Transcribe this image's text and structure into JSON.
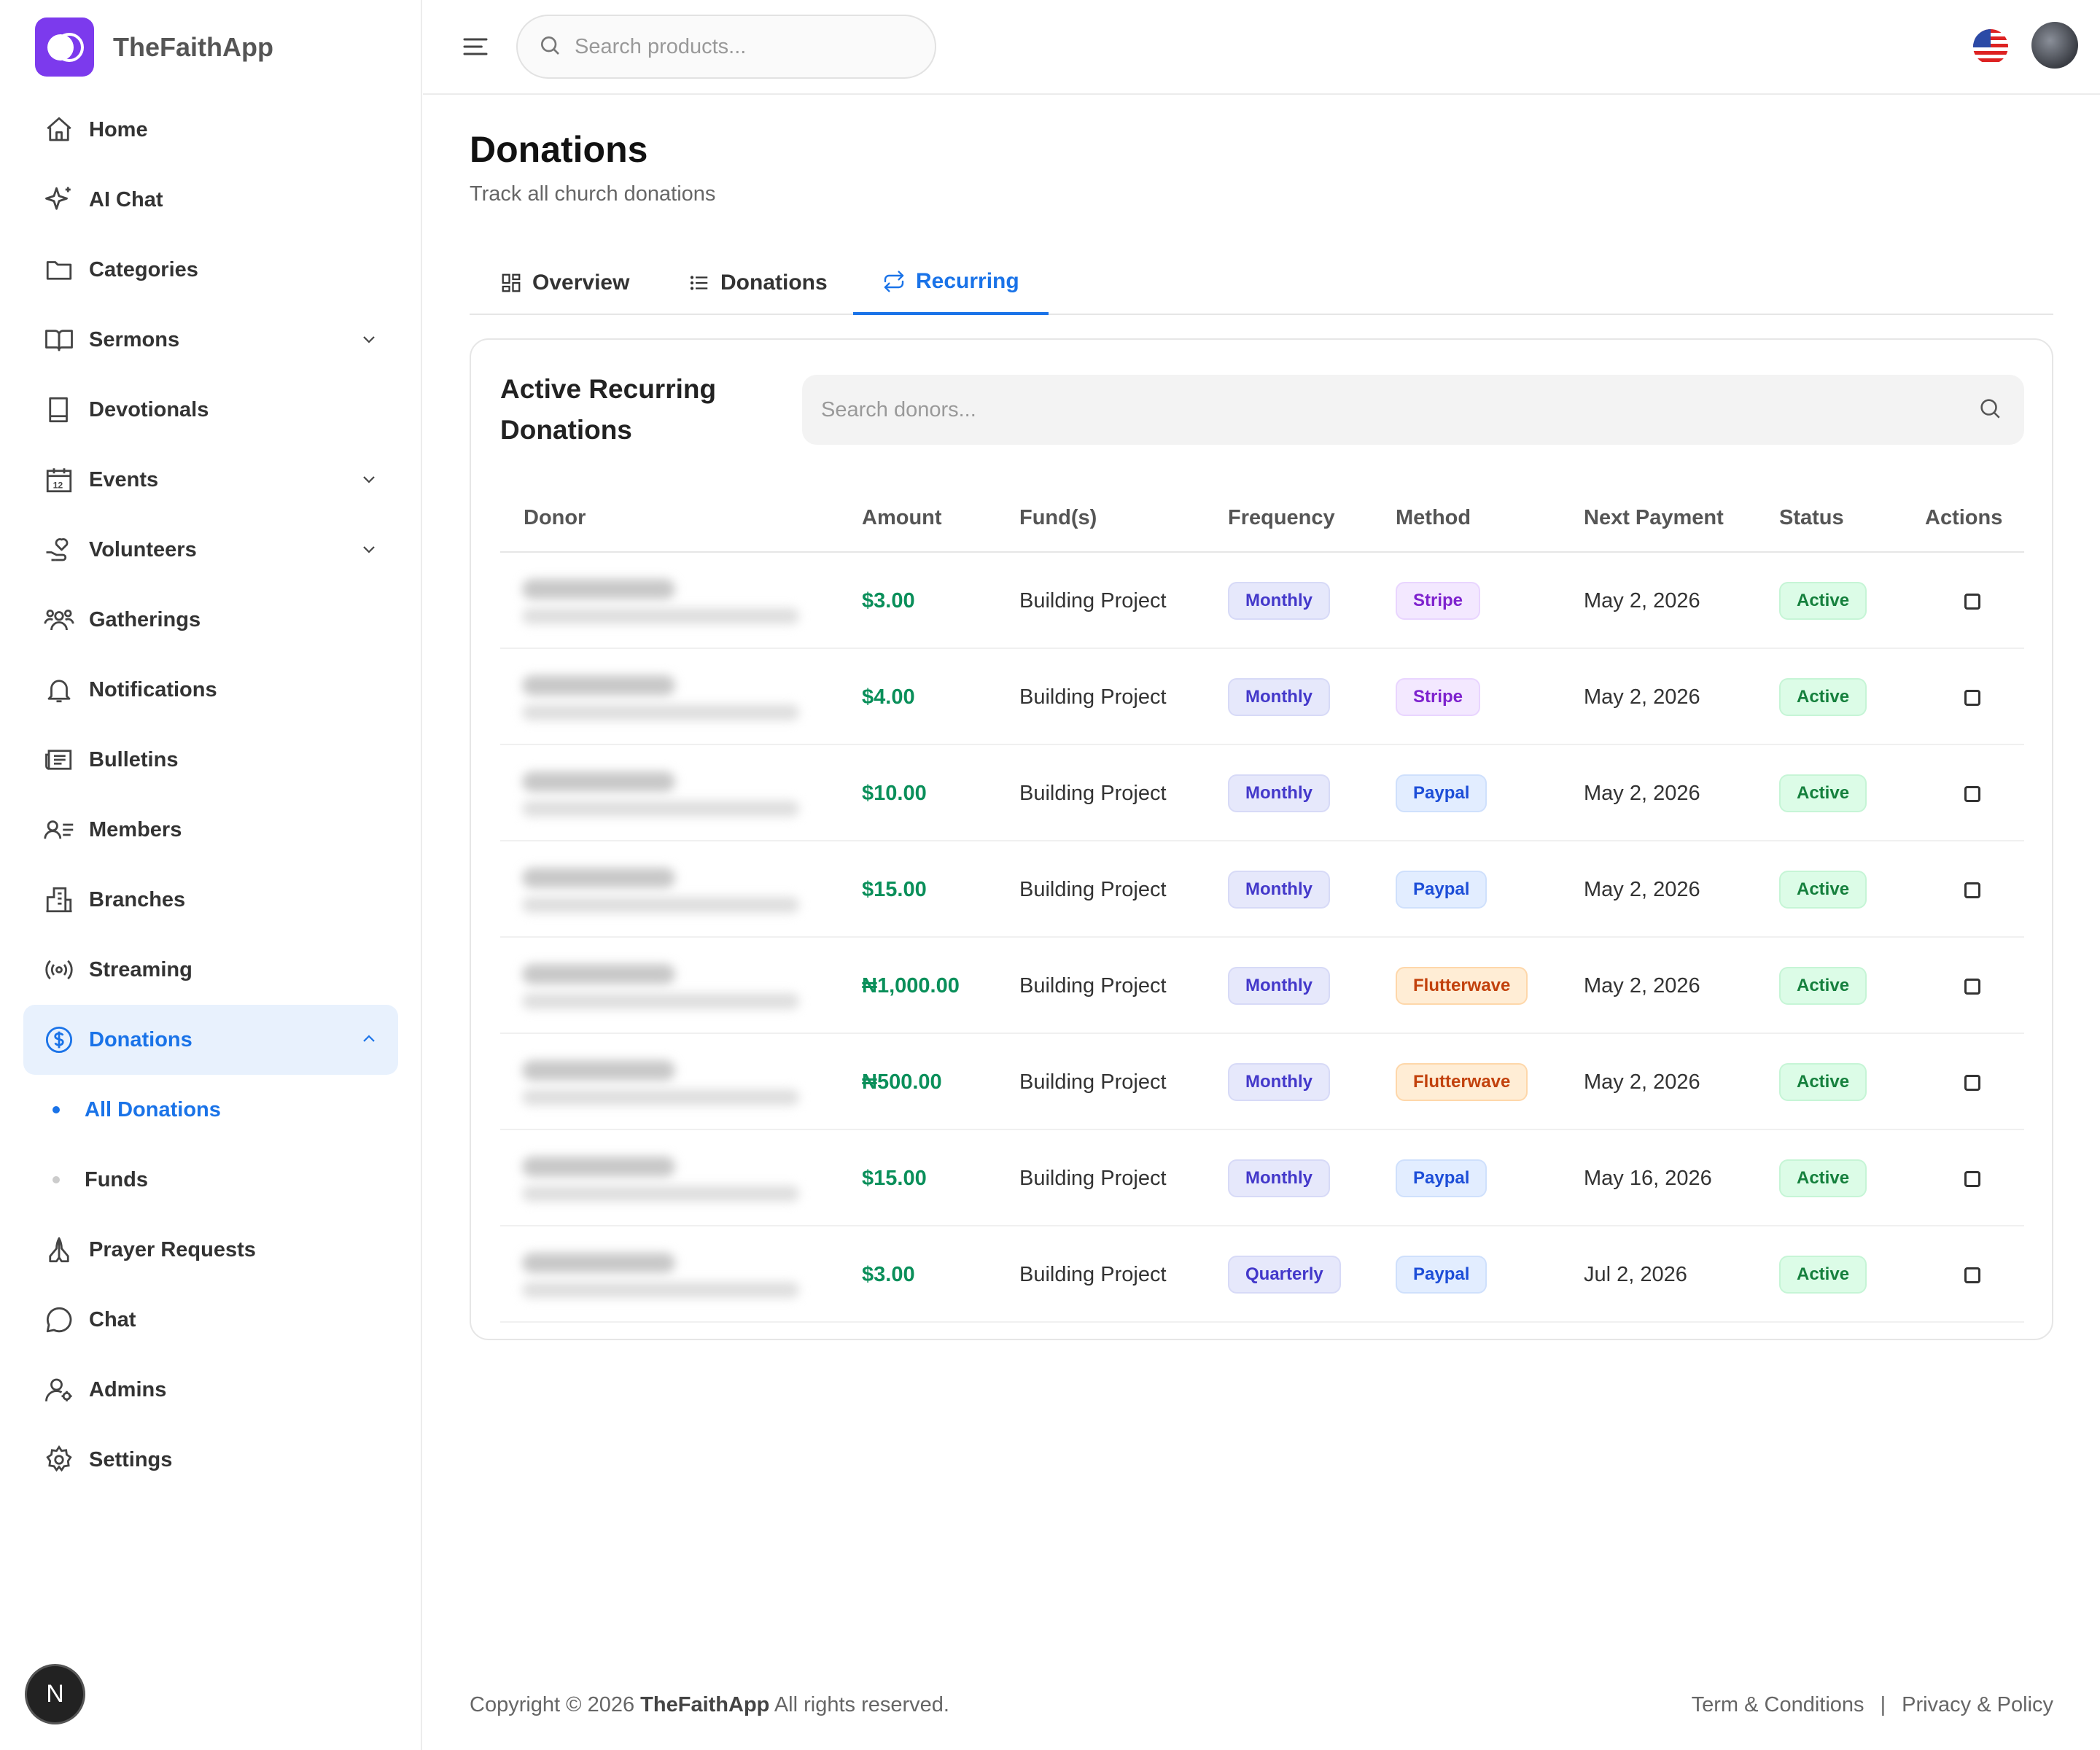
{
  "app": {
    "name": "TheFaithApp"
  },
  "colors": {
    "brand": "#7c3aed",
    "accent": "#1a73e8",
    "amount": "#0a8f5a"
  },
  "sidebar": {
    "items": [
      {
        "label": "Home",
        "icon": "home-icon"
      },
      {
        "label": "AI Chat",
        "icon": "sparkle-icon"
      },
      {
        "label": "Categories",
        "icon": "folder-icon"
      },
      {
        "label": "Sermons",
        "icon": "book-open-icon"
      },
      {
        "label": "Devotionals",
        "icon": "book-icon"
      },
      {
        "label": "Events",
        "icon": "calendar-icon"
      },
      {
        "label": "Volunteers",
        "icon": "hand-heart-icon"
      },
      {
        "label": "Gatherings",
        "icon": "users-icon"
      },
      {
        "label": "Notifications",
        "icon": "bell-icon"
      },
      {
        "label": "Bulletins",
        "icon": "newspaper-icon"
      },
      {
        "label": "Members",
        "icon": "user-list-icon"
      },
      {
        "label": "Branches",
        "icon": "building-icon"
      },
      {
        "label": "Streaming",
        "icon": "broadcast-icon"
      },
      {
        "label": "Donations",
        "icon": "dollar-circle-icon"
      },
      {
        "label": "All Donations"
      },
      {
        "label": "Funds"
      },
      {
        "label": "Prayer Requests",
        "icon": "praying-hands-icon"
      },
      {
        "label": "Chat",
        "icon": "chat-bubble-icon"
      },
      {
        "label": "Admins",
        "icon": "user-gear-icon"
      },
      {
        "label": "Settings",
        "icon": "gear-icon"
      }
    ],
    "badge": "N"
  },
  "topbar": {
    "search_placeholder": "Search products..."
  },
  "page": {
    "title": "Donations",
    "subtitle": "Track all church donations"
  },
  "tabs": [
    {
      "label": "Overview",
      "icon": "grid-icon"
    },
    {
      "label": "Donations",
      "icon": "list-icon"
    },
    {
      "label": "Recurring",
      "icon": "repeat-icon",
      "active": true
    }
  ],
  "card": {
    "title": "Active Recurring Donations",
    "search_placeholder": "Search donors...",
    "columns": [
      "Donor",
      "Amount",
      "Fund(s)",
      "Frequency",
      "Method",
      "Next Payment",
      "Status",
      "Actions"
    ],
    "rows": [
      {
        "amount": "$3.00",
        "fund": "Building Project",
        "frequency": "Monthly",
        "method": "Stripe",
        "next": "May 2, 2026",
        "status": "Active"
      },
      {
        "amount": "$4.00",
        "fund": "Building Project",
        "frequency": "Monthly",
        "method": "Stripe",
        "next": "May 2, 2026",
        "status": "Active"
      },
      {
        "amount": "$10.00",
        "fund": "Building Project",
        "frequency": "Monthly",
        "method": "Paypal",
        "next": "May 2, 2026",
        "status": "Active"
      },
      {
        "amount": "$15.00",
        "fund": "Building Project",
        "frequency": "Monthly",
        "method": "Paypal",
        "next": "May 2, 2026",
        "status": "Active"
      },
      {
        "amount": "₦1,000.00",
        "fund": "Building Project",
        "frequency": "Monthly",
        "method": "Flutterwave",
        "next": "May 2, 2026",
        "status": "Active"
      },
      {
        "amount": "₦500.00",
        "fund": "Building Project",
        "frequency": "Monthly",
        "method": "Flutterwave",
        "next": "May 2, 2026",
        "status": "Active"
      },
      {
        "amount": "$15.00",
        "fund": "Building Project",
        "frequency": "Monthly",
        "method": "Paypal",
        "next": "May 16, 2026",
        "status": "Active"
      },
      {
        "amount": "$3.00",
        "fund": "Building Project",
        "frequency": "Quarterly",
        "method": "Paypal",
        "next": "Jul 2, 2026",
        "status": "Active"
      }
    ]
  },
  "footer": {
    "copyright_prefix": "Copyright © 2026",
    "brand": "TheFaithApp",
    "copyright_suffix": "All rights reserved.",
    "terms": "Term & Conditions",
    "separator": "|",
    "privacy": "Privacy & Policy"
  }
}
